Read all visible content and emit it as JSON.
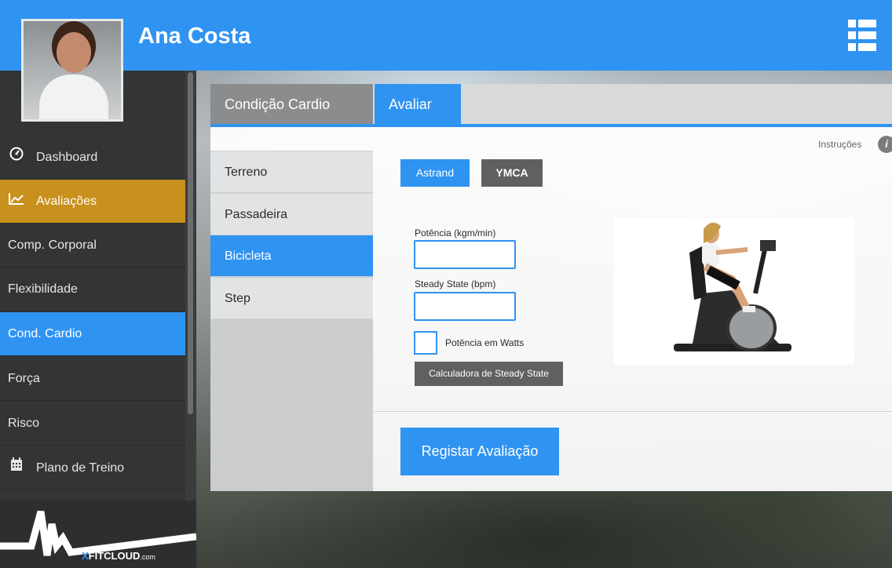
{
  "header": {
    "user_name": "Ana Costa",
    "menu_icon": "list-icon"
  },
  "sidebar": {
    "items": [
      {
        "label": "Dashboard",
        "icon": "dashboard-icon"
      },
      {
        "label": "Avaliações",
        "icon": "chart-line-icon"
      },
      {
        "label": "Comp. Corporal"
      },
      {
        "label": "Flexibilidade"
      },
      {
        "label": "Cond. Cardio"
      },
      {
        "label": "Força"
      },
      {
        "label": "Risco"
      },
      {
        "label": "Plano de Treino",
        "icon": "calendar-icon"
      }
    ],
    "logo": {
      "x": "X",
      "fit": "FITCLOUD",
      "com": ".com"
    }
  },
  "tabs": [
    {
      "label": "Condição Cardio"
    },
    {
      "label": "Avaliar"
    }
  ],
  "subnav": [
    {
      "label": "Terreno"
    },
    {
      "label": "Passadeira"
    },
    {
      "label": "Bicicleta"
    },
    {
      "label": "Step"
    }
  ],
  "form": {
    "instructions_label": "Instruções",
    "instructions_icon": "i",
    "protocol_buttons": [
      "Astrand",
      "YMCA"
    ],
    "power_label": "Potência (kgm/min)",
    "power_value": "",
    "steady_label": "Steady State (bpm)",
    "steady_value": "",
    "watts_checkbox_label": "Potência em Watts",
    "watts_checked": false,
    "calc_button": "Calculadora de Steady State",
    "register_button": "Registar Avaliação"
  },
  "colors": {
    "accent_blue": "#2f93f2",
    "active_gold": "#c8901d",
    "sidebar_dark": "#323435",
    "button_gray": "#5f6062"
  }
}
